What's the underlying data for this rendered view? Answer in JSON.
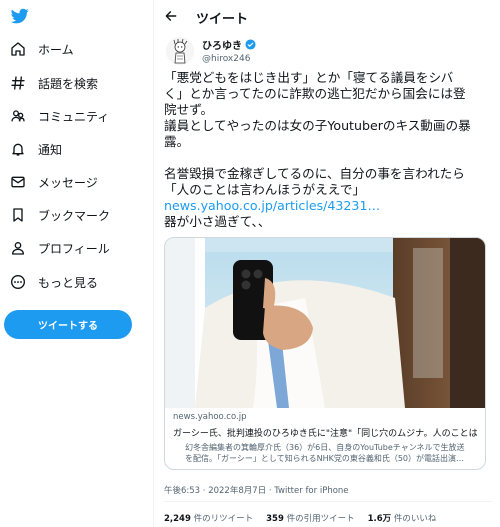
{
  "sidebar": {
    "items": [
      {
        "label": "ホーム",
        "icon": "home-icon"
      },
      {
        "label": "話題を検索",
        "icon": "hashtag-icon"
      },
      {
        "label": "コミュニティ",
        "icon": "people-icon"
      },
      {
        "label": "通知",
        "icon": "bell-icon"
      },
      {
        "label": "メッセージ",
        "icon": "envelope-icon"
      },
      {
        "label": "ブックマーク",
        "icon": "bookmark-icon"
      },
      {
        "label": "プロフィール",
        "icon": "person-icon"
      },
      {
        "label": "もっと見る",
        "icon": "more-icon"
      }
    ],
    "tweet_button": "ツイートする"
  },
  "header": {
    "title": "ツイート"
  },
  "tweet": {
    "author_name": "ひろゆき",
    "handle": "@hirox246",
    "lines": [
      "「悪党どもをはじき出す」とか「寝てる議員をシバ",
      "く」とか言ってたのに詐欺の逃亡犯だから国会には登",
      "院せず。",
      "議員としてやったのは女の子Youtuberのキス動画の暴",
      "露。"
    ],
    "lines2": [
      "名誉毀損で金稼ぎしてるのに、自分の事を言われたら",
      "「人のことは言わんほうがええで」"
    ],
    "link": "news.yahoo.co.jp/articles/43231…",
    "last_line": "器が小さ過ぎて、、"
  },
  "card": {
    "domain": "news.yahoo.co.jp",
    "title": "ガーシー氏、批判連投のひろゆき氏に\"注意\"「同じ穴のムジナ。人のことは言…",
    "desc_line1": "幻冬舎編集者の箕輪厚介氏（36）が6日、自身のYouTubeチャンネルで生放送",
    "desc_line2": "を配信。「ガーシー」として知られるNHK党の東谷義和氏（50）が電話出演…"
  },
  "timestamp": "午後6:53 · 2022年8月7日 · Twitter for iPhone",
  "stats": [
    {
      "count": "2,249",
      "label": "件のリツイート"
    },
    {
      "count": "359",
      "label": "件の引用ツイート"
    },
    {
      "count": "1.6万",
      "label": "件のいいね"
    }
  ],
  "colors": {
    "accent": "#1d9bf0",
    "text": "#0f1419",
    "muted": "#536471"
  }
}
